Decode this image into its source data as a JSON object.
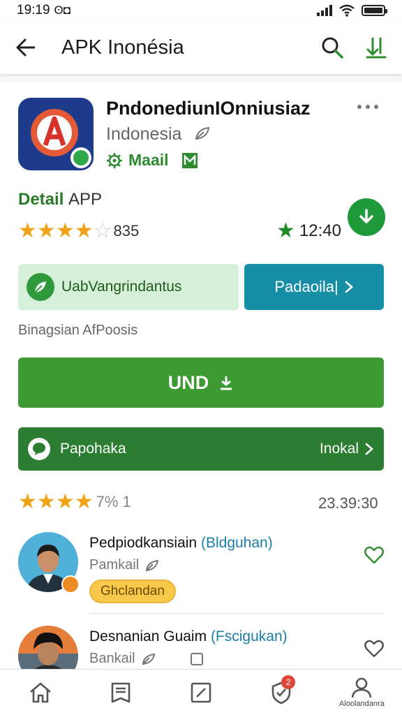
{
  "status_bar": {
    "time": "19:19",
    "extra": "ʘ◘"
  },
  "app_bar": {
    "title": "APK Inonésia"
  },
  "app": {
    "name": "PndonediunIOnniusiaz",
    "country": "Indonesia",
    "developer": "Maail"
  },
  "details": {
    "label_bold": "Detail",
    "label_light": "APP",
    "rating_stars": 4,
    "rating_count": "835",
    "right_value": "12:40"
  },
  "buttons": {
    "light_label": "UabVangrindantus",
    "teal_label": "Padaoila|",
    "meta_text": "Binagsian AfPoosis",
    "primary_label": "UND",
    "dark_left_label": "Papohaka",
    "dark_right_label": "Inokal"
  },
  "reviews_header": {
    "stars": 4,
    "count": "7% 1",
    "time": "23.39:30"
  },
  "reviews": [
    {
      "name": "Pedpiodkansiain",
      "tag": "(Bldguhan)",
      "sub": "Pamkail",
      "badge": "Ghclandan"
    },
    {
      "name": "Desnanian Guaim",
      "tag": "(Fscigukan)",
      "sub": "Bankail"
    }
  ],
  "bottom_nav": {
    "notif_count": "2",
    "profile_label": "Aloolandanra"
  },
  "colors": {
    "primary_green": "#3d9a32",
    "dark_green": "#2b7d32",
    "teal": "#168ea6",
    "star": "#f0a318"
  }
}
